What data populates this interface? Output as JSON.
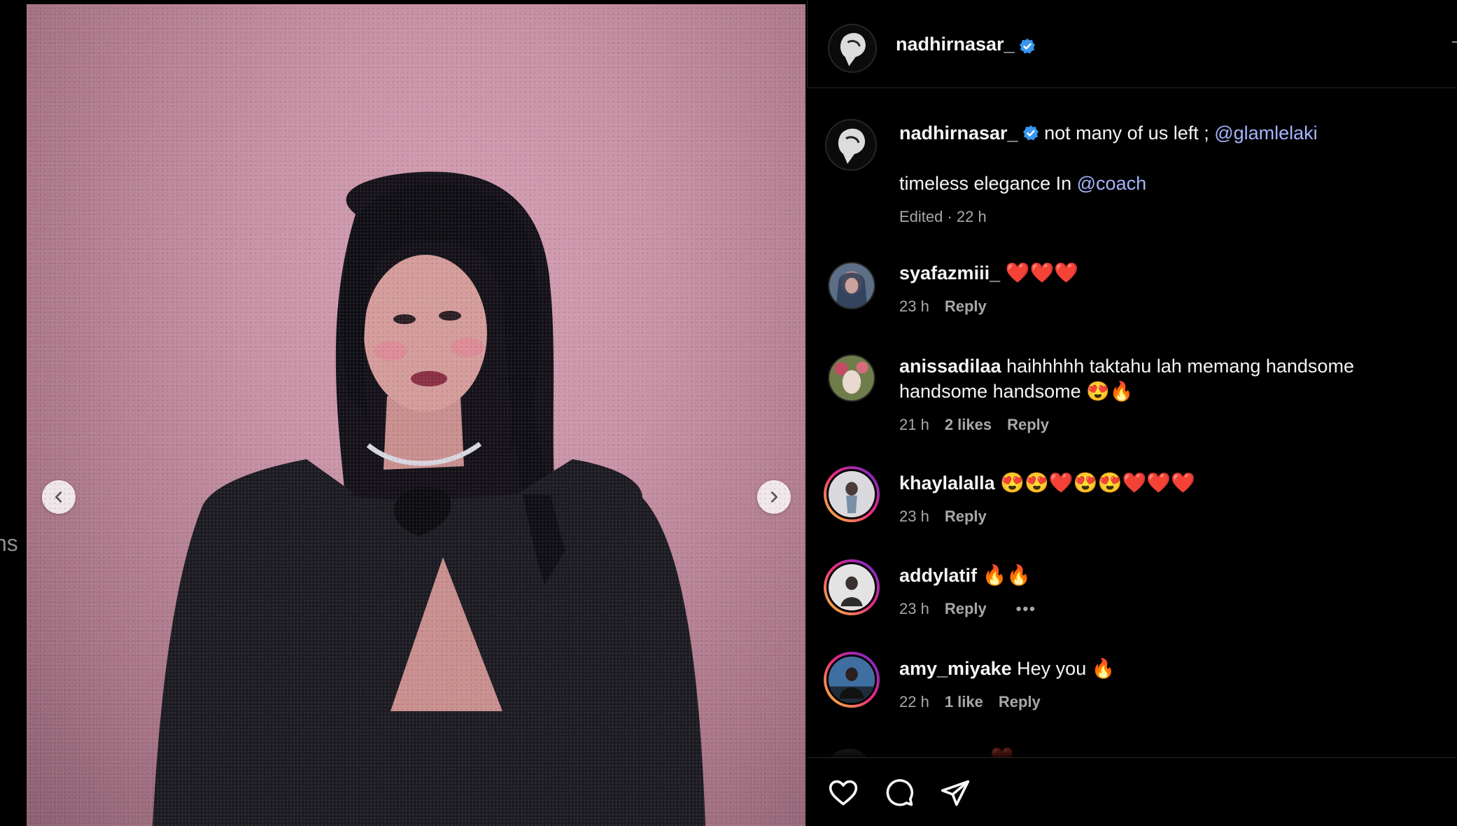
{
  "sidebar_fragment": {
    "text": "ns"
  },
  "media": {
    "prev_icon": "chevron-left-icon",
    "next_icon": "chevron-right-icon"
  },
  "header": {
    "username": "nadhirnasar_",
    "verified": true
  },
  "caption": {
    "username": "nadhirnasar_",
    "text_part1": "not many of us left ; ",
    "mention1": "@glamlelaki",
    "line2_text": "timeless elegance In ",
    "mention2": "@coach",
    "meta": "Edited · 22 h"
  },
  "comments": [
    {
      "username": "syafazmiii_",
      "text": "❤️❤️❤️",
      "time": "23 h",
      "likes": "",
      "reply_label": "Reply"
    },
    {
      "username": "anissadilaa",
      "text": "haihhhhh taktahu lah memang handsome handsome handsome 😍🔥",
      "time": "21 h",
      "likes": "2 likes",
      "reply_label": "Reply"
    },
    {
      "username": "khaylalalla",
      "text": "😍😍❤️😍😍❤️❤️❤️",
      "time": "23 h",
      "likes": "",
      "reply_label": "Reply"
    },
    {
      "username": "addylatif",
      "text": "🔥🔥",
      "time": "23 h",
      "likes": "",
      "reply_label": "Reply",
      "more": "•••"
    },
    {
      "username": "amy_miyake",
      "text": "Hey you 🔥",
      "time": "22 h",
      "likes": "1 like",
      "reply_label": "Reply"
    }
  ],
  "partial_comment": {
    "text": "❤️"
  },
  "actions": {
    "like_icon": "heart-icon",
    "comment_icon": "comment-icon",
    "share_icon": "share-icon"
  },
  "colors": {
    "background": "#000000",
    "mention": "#a5b4fc",
    "verified": "#3897f0",
    "muted": "#a8a8a8"
  }
}
